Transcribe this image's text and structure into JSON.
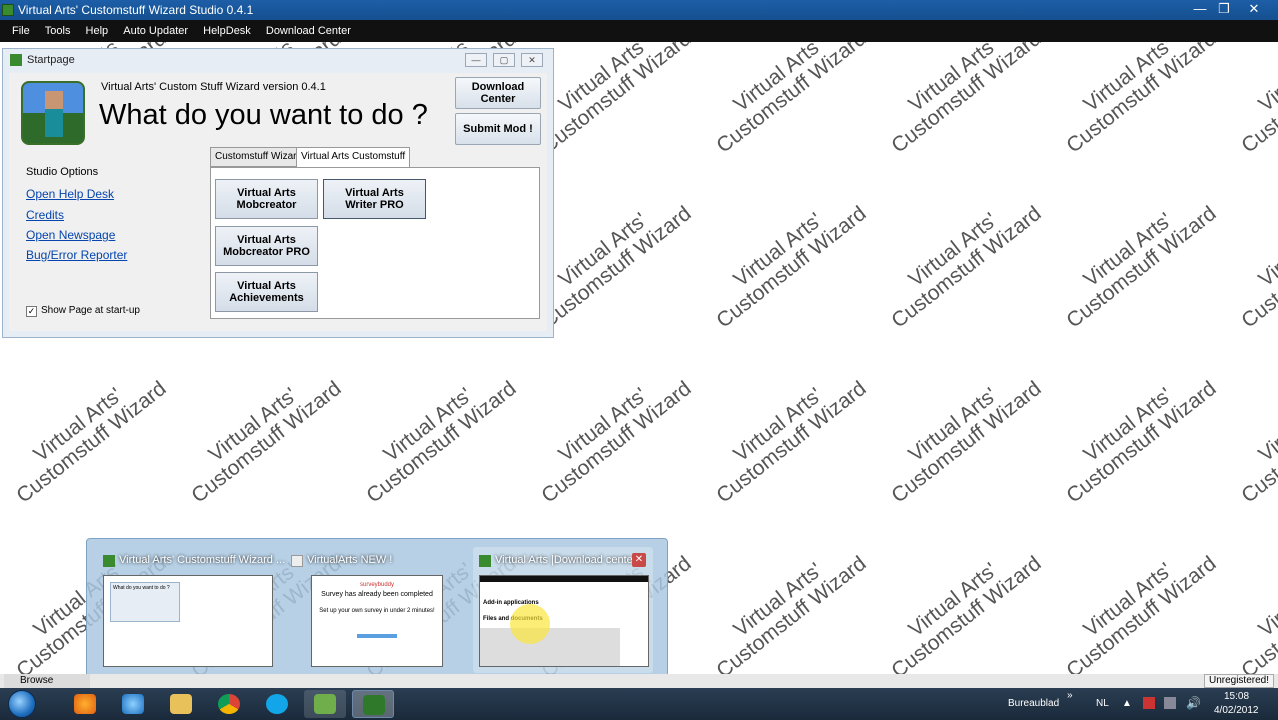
{
  "window": {
    "title": "Virtual Arts' Customstuff Wizard Studio 0.4.1",
    "controls": {
      "minimize": "—",
      "maximize": "❐",
      "close": "✕"
    }
  },
  "menu": [
    "File",
    "Tools",
    "Help",
    "Auto Updater",
    "HelpDesk",
    "Download Center"
  ],
  "watermark": {
    "line1": "Virtual Arts'",
    "line2": "Customstuff Wizard"
  },
  "startpage": {
    "title": "Startpage",
    "version_text": "Virtual Arts' Custom Stuff Wizard version 0.4.1",
    "heading": "What do you want to do ?",
    "download_center_btn": "Download Center",
    "submit_mod_btn": "Submit Mod !",
    "studio_options_title": "Studio Options",
    "links": [
      "Open Help Desk",
      "Credits",
      "Open Newspage",
      "Bug/Error Reporter"
    ],
    "show_on_startup": {
      "label": "Show Page at start-up",
      "checked": true
    },
    "tabs": [
      "Customstuff Wizard",
      "Virtual Arts Customstuff"
    ],
    "active_tab": 1,
    "tools": [
      "Virtual Arts Mobcreator",
      "Virtual Arts Writer PRO",
      "Virtual Arts Mobcreator PRO",
      "Virtual Arts Achievements"
    ]
  },
  "thumbnails": [
    {
      "title": "Virtual Arts' Customstuff Wizard ...",
      "preview_heading": "What do you want to do ?"
    },
    {
      "title": "VirtualArts NEW !",
      "preview_brand": "surveybuddy",
      "preview_heading": "Survey has already been completed",
      "preview_sub": "Set up your own survey in under 2 minutes!"
    },
    {
      "title": "Virtual Arts |Download center",
      "preview_heading": "Add-in applications",
      "preview_sub": "Files and documents"
    }
  ],
  "statusbar": {
    "left": "Browse location",
    "right": "Unregistered!"
  },
  "taskbar": {
    "toolbar_label": "Bureaublad",
    "language": "NL",
    "time": "15:08",
    "date": "4/02/2012"
  },
  "colors": {
    "titlebar": "#1d5ea8",
    "menubar": "#111111",
    "link": "#0645ad",
    "taskbar": "#1a2a3b"
  }
}
